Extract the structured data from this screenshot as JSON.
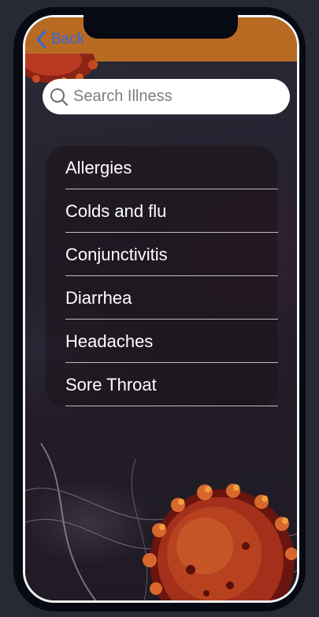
{
  "header": {
    "back_label": "Back"
  },
  "search": {
    "placeholder": "Search Illness"
  },
  "illnesses": [
    {
      "label": "Allergies"
    },
    {
      "label": "Colds and flu"
    },
    {
      "label": "Conjunctivitis"
    },
    {
      "label": "Diarrhea"
    },
    {
      "label": "Headaches"
    },
    {
      "label": "Sore Throat"
    }
  ],
  "colors": {
    "header_bar": "#b86a23",
    "back_link": "#2f6bd8",
    "phone_frame": "#070a12",
    "search_bg": "#ffffff",
    "list_text": "#ffffff"
  }
}
